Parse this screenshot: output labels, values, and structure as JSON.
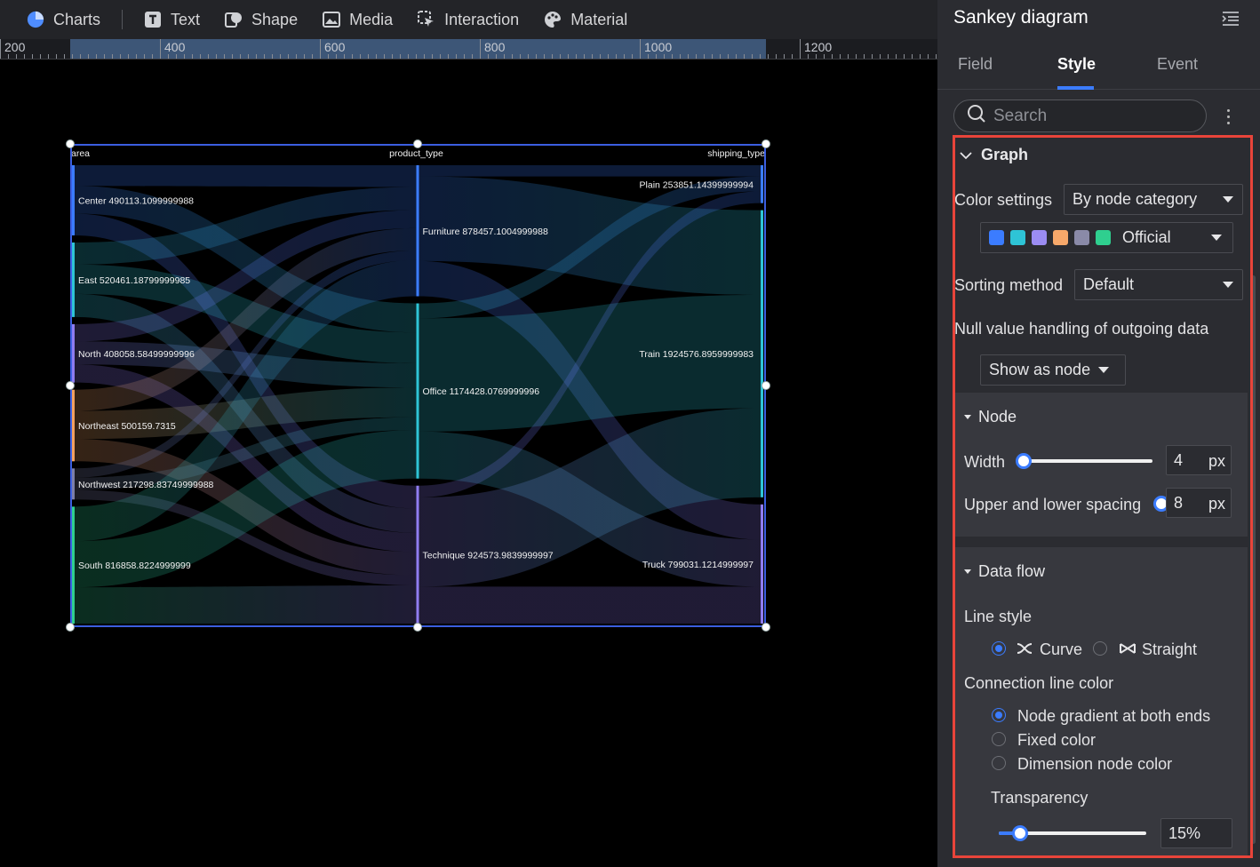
{
  "toolbar": {
    "items": [
      {
        "label": "Charts",
        "icon": "pie-chart-icon"
      },
      {
        "label": "Text",
        "icon": "text-icon"
      },
      {
        "label": "Shape",
        "icon": "shape-icon"
      },
      {
        "label": "Media",
        "icon": "image-icon"
      },
      {
        "label": "Interaction",
        "icon": "cursor-icon"
      },
      {
        "label": "Material",
        "icon": "palette-icon"
      }
    ]
  },
  "ruler": {
    "labels": [
      "200",
      "400",
      "600",
      "800",
      "1000",
      "1200"
    ]
  },
  "chart": {
    "column_headers": [
      "area",
      "product_type",
      "shipping_type"
    ]
  },
  "chart_data": {
    "type": "sankey",
    "levels": [
      "area",
      "product_type",
      "shipping_type"
    ],
    "nodes": [
      {
        "name": "Center",
        "level": "area",
        "value": 490113.1099999988,
        "label": "Center 490113.1099999988"
      },
      {
        "name": "East",
        "level": "area",
        "value": 520461.18799999985,
        "label": "East 520461.18799999985"
      },
      {
        "name": "North",
        "level": "area",
        "value": 408058.58499999996,
        "label": "North 408058.58499999996"
      },
      {
        "name": "Northeast",
        "level": "area",
        "value": 500159.7315,
        "label": "Northeast 500159.7315"
      },
      {
        "name": "Northwest",
        "level": "area",
        "value": 217298.83749999988,
        "label": "Northwest 217298.83749999988"
      },
      {
        "name": "South",
        "level": "area",
        "value": 816858.8224999999,
        "label": "South 816858.8224999999"
      },
      {
        "name": "Furniture",
        "level": "product_type",
        "value": 878457.1004999988,
        "label": "Furniture 878457.1004999988"
      },
      {
        "name": "Office",
        "level": "product_type",
        "value": 1174428.0769999996,
        "label": "Office 1174428.0769999996"
      },
      {
        "name": "Technique",
        "level": "product_type",
        "value": 924573.9839999997,
        "label": "Technique 924573.9839999997"
      },
      {
        "name": "Plain",
        "level": "shipping_type",
        "value": 253851.14399999994,
        "label": "Plain 253851.14399999994"
      },
      {
        "name": "Train",
        "level": "shipping_type",
        "value": 1924576.8959999983,
        "label": "Train 1924576.8959999983"
      },
      {
        "name": "Truck",
        "level": "shipping_type",
        "value": 799031.1214999997,
        "label": "Truck 799031.1214999997"
      }
    ],
    "node_colors": [
      "#3b7cff",
      "#2ec4d6",
      "#8f7cf0",
      "#f2a060",
      "#7d7fa8",
      "#2fcf8f"
    ]
  },
  "panel": {
    "title": "Sankey diagram",
    "tabs": [
      "Field",
      "Style",
      "Event"
    ],
    "active_tab": "Style",
    "search_placeholder": "Search",
    "graph": {
      "title": "Graph",
      "color_settings_label": "Color settings",
      "color_settings_value": "By node category",
      "palette_name": "Official",
      "palette_colors": [
        "#3b7cff",
        "#2ec4d6",
        "#9b8cf2",
        "#f7a86a",
        "#8a8aa8",
        "#2fcf8f"
      ],
      "sorting_label": "Sorting method",
      "sorting_value": "Default",
      "null_label": "Null value handling of outgoing data",
      "null_value": "Show as node"
    },
    "node": {
      "title": "Node",
      "width_label": "Width",
      "width_value": "4",
      "width_unit": "px",
      "spacing_label": "Upper and lower spacing",
      "spacing_value": "8",
      "spacing_unit": "px"
    },
    "data_flow": {
      "title": "Data flow",
      "line_style_label": "Line style",
      "curve_label": "Curve",
      "straight_label": "Straight",
      "line_style_selected": "Curve",
      "color_label": "Connection line color",
      "color_options": [
        "Node gradient at both ends",
        "Fixed color",
        "Dimension node color"
      ],
      "color_selected": "Node gradient at both ends",
      "transparency_label": "Transparency",
      "transparency_value": "15%",
      "transparency_fraction": 0.15
    }
  }
}
